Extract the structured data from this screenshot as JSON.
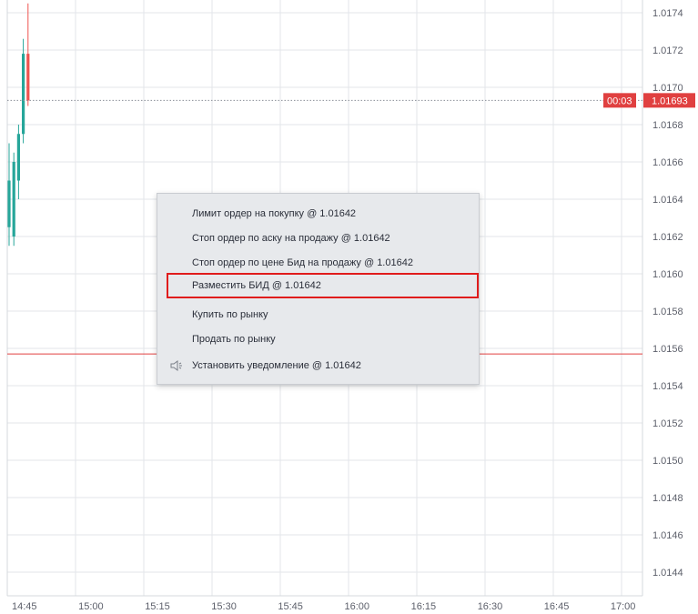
{
  "price_axis": {
    "labels": [
      "1.0174",
      "1.0172",
      "1.0170",
      "1.0168",
      "1.0166",
      "1.0164",
      "1.0162",
      "1.0160",
      "1.0158",
      "1.0156",
      "1.0154",
      "1.0152",
      "1.0150",
      "1.0148",
      "1.0146",
      "1.0144"
    ],
    "current_price_badge": "1.01693",
    "timer_badge": "00:03"
  },
  "time_axis": {
    "labels": [
      "14:45",
      "15:00",
      "15:15",
      "15:30",
      "15:45",
      "16:00",
      "16:15",
      "16:30",
      "16:45",
      "17:00"
    ]
  },
  "lines": {
    "current_price": 1.01693,
    "cursor_price": 1.01557
  },
  "colors": {
    "bull": "#26a69a",
    "bear": "#ef5350",
    "grid": "#e3e6ea",
    "price_line": "#e04040",
    "badge_bg": "#e04040",
    "highlight_border": "#e01c1c"
  },
  "candles": [
    {
      "time": "14:39",
      "open": 1.01625,
      "high": 1.0167,
      "low": 1.01615,
      "close": 1.0165
    },
    {
      "time": "14:40",
      "open": 1.0162,
      "high": 1.01665,
      "low": 1.01615,
      "close": 1.0166
    },
    {
      "time": "14:41",
      "open": 1.0165,
      "high": 1.0168,
      "low": 1.0164,
      "close": 1.01675
    },
    {
      "time": "14:42",
      "open": 1.01675,
      "high": 1.01726,
      "low": 1.0167,
      "close": 1.01718
    },
    {
      "time": "14:43",
      "open": 1.01718,
      "high": 1.01745,
      "low": 1.0169,
      "close": 1.01693
    }
  ],
  "context_menu": {
    "items": [
      {
        "label": "Лимит ордер на покупку @ 1.01642"
      },
      {
        "label": "Стоп ордер по аску на продажу @ 1.01642"
      },
      {
        "label": "Стоп ордер по цене Бид на продажу @ 1.01642"
      },
      {
        "label": "Разместить БИД @ 1.01642"
      },
      {
        "label": "Купить по рынку"
      },
      {
        "label": "Продать по рынку"
      },
      {
        "label": "Установить уведомление @ 1.01642",
        "icon": "speaker-icon"
      }
    ]
  }
}
